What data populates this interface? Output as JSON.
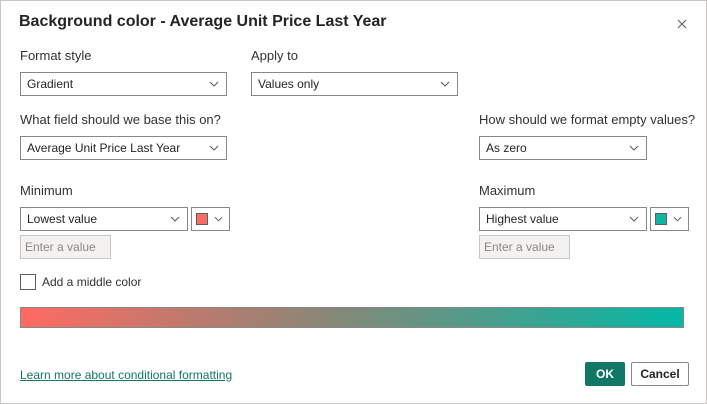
{
  "dialog": {
    "title": "Background color - Average Unit Price Last Year",
    "close_icon": "close-icon"
  },
  "format_style": {
    "label": "Format style",
    "value": "Gradient"
  },
  "apply_to": {
    "label": "Apply to",
    "value": "Values only"
  },
  "base_field": {
    "label": "What field should we base this on?",
    "value": "Average Unit Price Last Year"
  },
  "empty_values": {
    "label": "How should we format empty values?",
    "value": "As zero"
  },
  "minimum": {
    "label": "Minimum",
    "value": "Lowest value",
    "placeholder": "Enter a value",
    "color": "#f86b64"
  },
  "maximum": {
    "label": "Maximum",
    "value": "Highest value",
    "placeholder": "Enter a value",
    "color": "#12b5a2"
  },
  "middle_color": {
    "label": "Add a middle color",
    "checked": false
  },
  "gradient": {
    "start_color": "#ff6a62",
    "end_color": "#03b8a5"
  },
  "footer": {
    "link": "Learn more about conditional formatting",
    "ok_label": "OK",
    "cancel_label": "Cancel"
  },
  "colors": {
    "accent": "#117865",
    "border": "#8a8886"
  }
}
